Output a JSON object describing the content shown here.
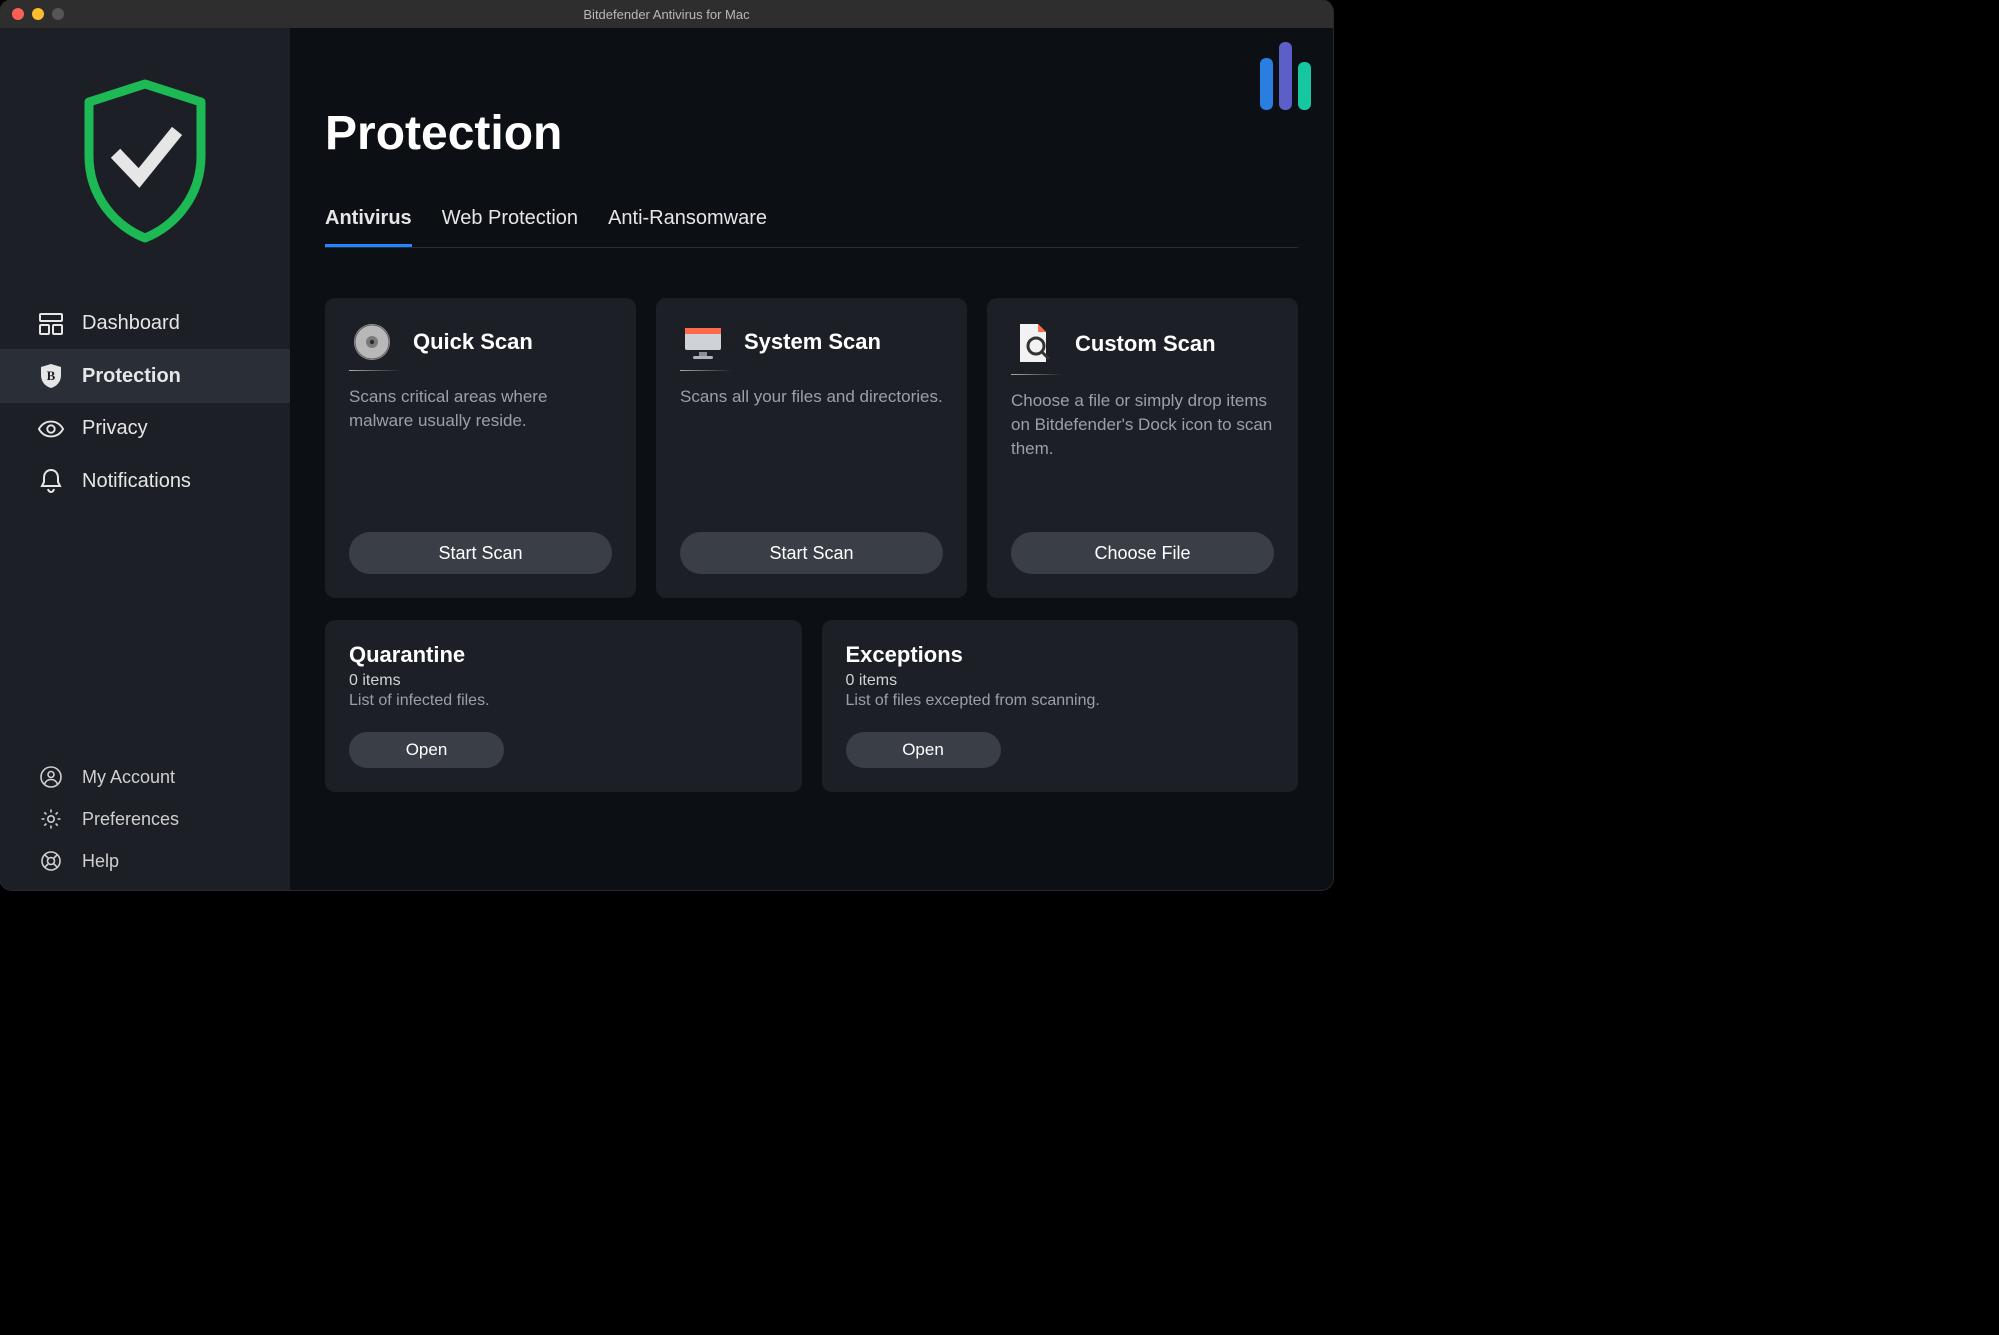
{
  "titlebar": {
    "title": "Bitdefender Antivirus for Mac"
  },
  "sidebar": {
    "items": [
      {
        "label": "Dashboard"
      },
      {
        "label": "Protection"
      },
      {
        "label": "Privacy"
      },
      {
        "label": "Notifications"
      }
    ],
    "bottom": [
      {
        "label": "My Account"
      },
      {
        "label": "Preferences"
      },
      {
        "label": "Help"
      }
    ]
  },
  "page": {
    "title": "Protection"
  },
  "tabs": [
    {
      "label": "Antivirus"
    },
    {
      "label": "Web Protection"
    },
    {
      "label": "Anti-Ransomware"
    }
  ],
  "scanCards": [
    {
      "title": "Quick Scan",
      "desc": "Scans critical areas where malware usually reside.",
      "button": "Start Scan"
    },
    {
      "title": "System Scan",
      "desc": "Scans all your files and directories.",
      "button": "Start Scan"
    },
    {
      "title": "Custom Scan",
      "desc": "Choose a file or simply drop items on Bitdefender's Dock icon to scan them.",
      "button": "Choose File"
    }
  ],
  "infoCards": [
    {
      "title": "Quarantine",
      "count": "0 items",
      "desc": "List of infected files.",
      "button": "Open"
    },
    {
      "title": "Exceptions",
      "count": "0 items",
      "desc": "List of files excepted from scanning.",
      "button": "Open"
    }
  ]
}
